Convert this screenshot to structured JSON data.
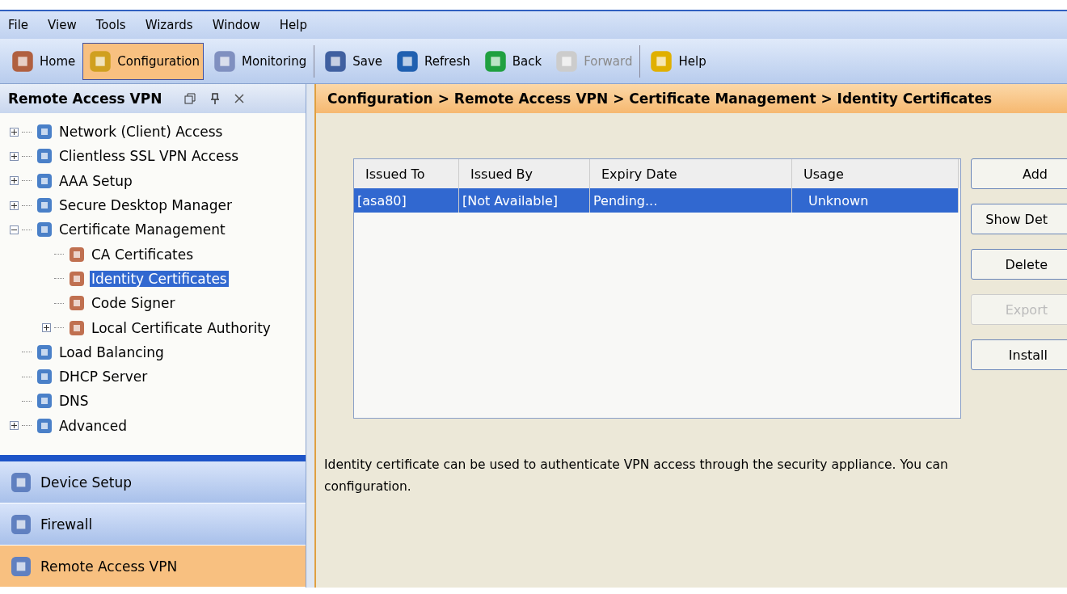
{
  "menu_bar": [
    "File",
    "View",
    "Tools",
    "Wizards",
    "Window",
    "Help"
  ],
  "toolbar": [
    {
      "label": "Home",
      "selected": false,
      "disabled": false
    },
    {
      "label": "Configuration",
      "selected": true,
      "disabled": false
    },
    {
      "label": "Monitoring",
      "selected": false,
      "disabled": false
    },
    {
      "label": "Save",
      "selected": false,
      "disabled": false
    },
    {
      "label": "Refresh",
      "selected": false,
      "disabled": false
    },
    {
      "label": "Back",
      "selected": false,
      "disabled": false
    },
    {
      "label": "Forward",
      "selected": false,
      "disabled": true
    },
    {
      "label": "Help",
      "selected": false,
      "disabled": false
    }
  ],
  "sidebar": {
    "title": "Remote Access VPN",
    "tree": [
      {
        "label": "Network (Client) Access",
        "selected": false,
        "expanded": false
      },
      {
        "label": "Clientless SSL VPN Access",
        "selected": false,
        "expanded": false
      },
      {
        "label": "AAA Setup",
        "selected": false,
        "expanded": false
      },
      {
        "label": "Secure Desktop Manager",
        "selected": false,
        "expanded": false
      },
      {
        "label": "Certificate Management",
        "selected": false,
        "expanded": true,
        "children": [
          {
            "label": "CA Certificates",
            "selected": false
          },
          {
            "label": "Identity Certificates",
            "selected": true
          },
          {
            "label": "Code Signer",
            "selected": false
          },
          {
            "label": "Local Certificate Authority",
            "selected": false,
            "expanded": false
          }
        ]
      },
      {
        "label": "Load Balancing",
        "selected": false
      },
      {
        "label": "DHCP Server",
        "selected": false
      },
      {
        "label": "DNS",
        "selected": false
      },
      {
        "label": "Advanced",
        "selected": false,
        "expanded": false
      }
    ],
    "nav_buttons": [
      {
        "label": "Device Setup",
        "selected": false
      },
      {
        "label": "Firewall",
        "selected": false
      },
      {
        "label": "Remote Access VPN",
        "selected": true
      }
    ]
  },
  "breadcrumb": "Configuration > Remote Access VPN > Certificate Management > Identity Certificates",
  "table": {
    "columns": [
      "Issued To",
      "Issued By",
      "Expiry Date",
      "Usage"
    ],
    "rows": [
      {
        "cells": [
          "[asa80]",
          "[Not Available]",
          "Pending...",
          "Unknown"
        ],
        "selected": true
      }
    ]
  },
  "buttons": [
    {
      "label": "Add",
      "disabled": false
    },
    {
      "label": "Show Det",
      "disabled": false
    },
    {
      "label": "Delete",
      "disabled": false
    },
    {
      "label": "Export",
      "disabled": true
    },
    {
      "label": "Install",
      "disabled": false
    }
  ],
  "description": "Identity certificate can be used to authenticate VPN access through the security appliance. You can configuration."
}
